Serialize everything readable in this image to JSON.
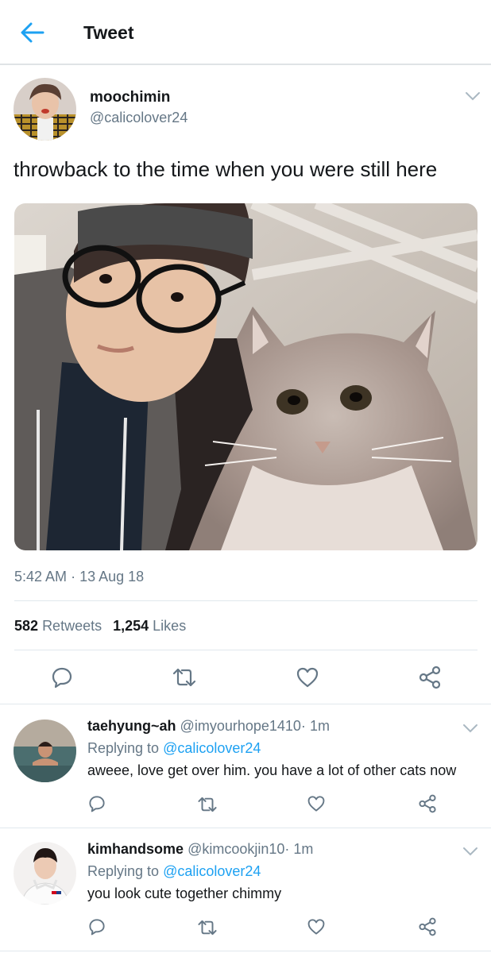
{
  "header": {
    "title": "Tweet"
  },
  "tweet": {
    "author_name": "moochimin",
    "author_handle": "@calicolover24",
    "text": "throwback to the time when you were still here",
    "time": "5:42 AM",
    "separator": "·",
    "date": "13 Aug 18",
    "retweets_count": "582",
    "retweets_label": "Retweets",
    "likes_count": "1,254",
    "likes_label": "Likes"
  },
  "replies": [
    {
      "name": "taehyung~ah",
      "handle": "@imyourhope1410",
      "separator": "·",
      "time": "1m",
      "replying_label": "Replying to",
      "replying_to": "@calicolover24",
      "text": "aweee, love get over him. you have a lot of other cats now"
    },
    {
      "name": "kimhandsome",
      "handle": "@kimcookjin10",
      "separator": "·",
      "time": "1m",
      "replying_label": "Replying to",
      "replying_to": "@calicolover24",
      "text": "you look cute together chimmy"
    }
  ],
  "colors": {
    "accent": "#1da1f2",
    "text": "#14171a",
    "secondary": "#657786",
    "divider": "#e1e8ed"
  },
  "icons": [
    "back-arrow-icon",
    "chevron-down-icon",
    "reply-icon",
    "retweet-icon",
    "like-icon",
    "share-icon"
  ]
}
